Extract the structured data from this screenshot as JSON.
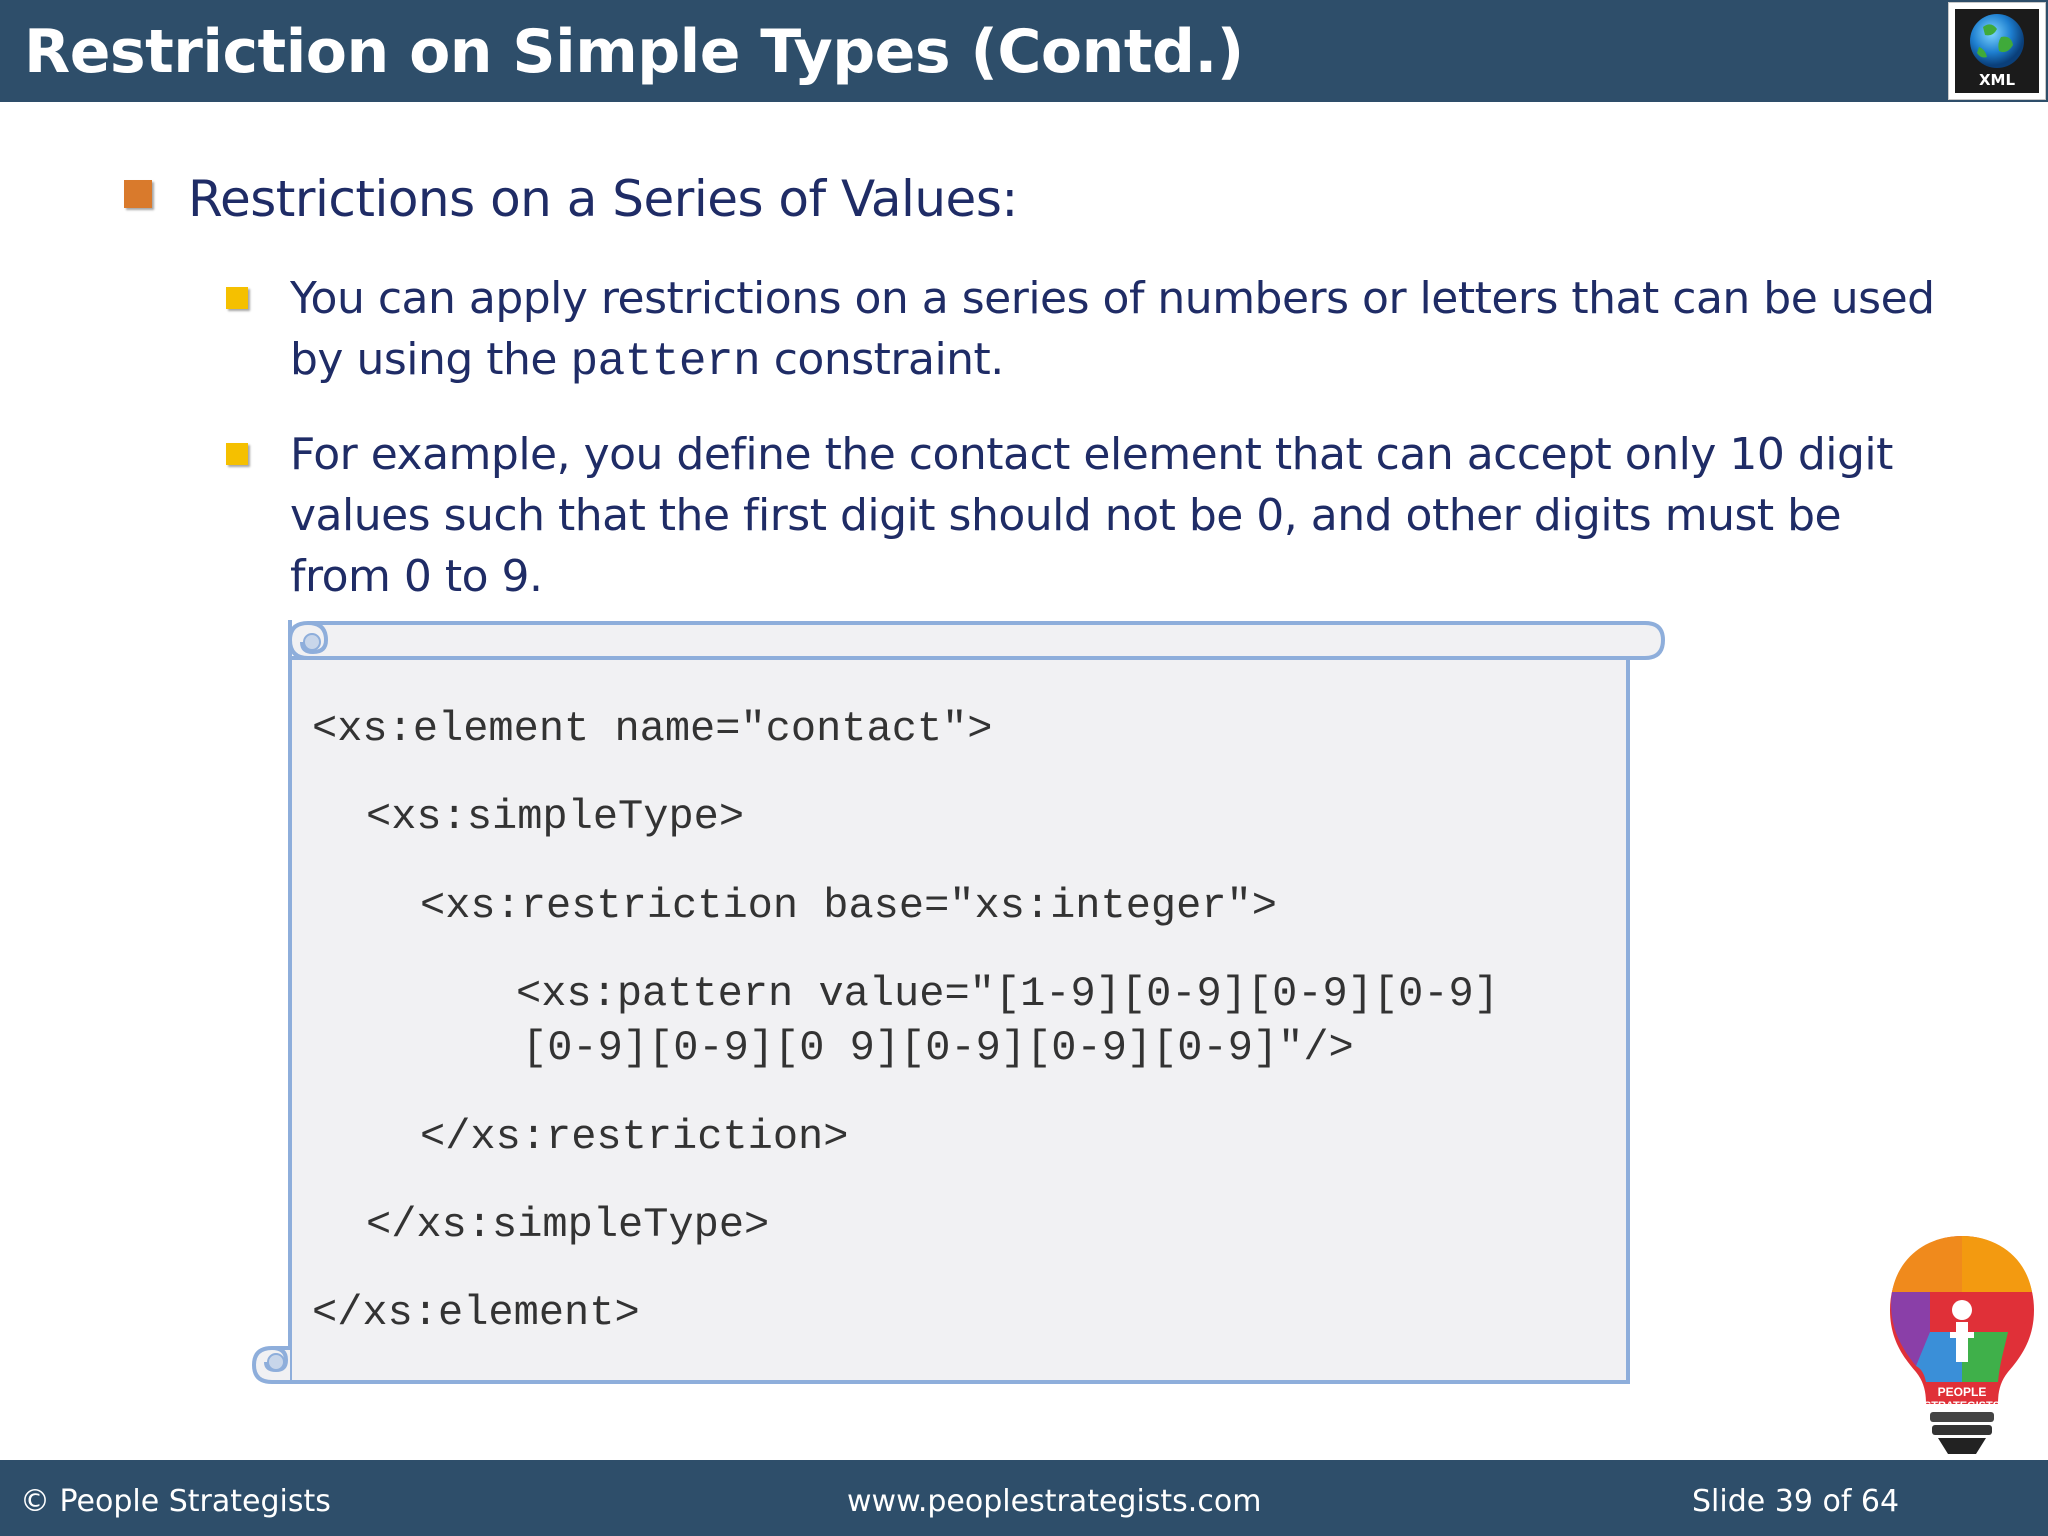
{
  "header": {
    "title": "Restriction on Simple Types (Contd.)",
    "badge_label": "XML",
    "bg_color": "#2e4e6a"
  },
  "content": {
    "heading": "Restrictions on a Series of Values:",
    "bullet1_before": "You can apply restrictions on a series of numbers or letters that can be used by using the ",
    "bullet1_code": "pattern",
    "bullet1_after": " constraint.",
    "bullet2": "For example, you define the contact element that can accept only 10 digit values such that the first digit should not be 0, and other digits must be from 0 to 9."
  },
  "code": {
    "lines": [
      "<xs:element name=\"contact\">",
      "<xs:simpleType>",
      "<xs:restriction base=\"xs:integer\">",
      "<xs:pattern value=\"[1-9][0-9][0-9][0-9]",
      "[0-9][0-9][0 9][0-9][0-9][0-9]\"/>",
      "</xs:restriction>",
      "</xs:simpleType>",
      "</xs:element>"
    ]
  },
  "footer": {
    "copyright": "© People Strategists",
    "website": "www.peoplestrategists.com",
    "slide_number": "Slide 39 of 64"
  },
  "logo": {
    "text_line1": "PEOPLE",
    "text_line2": "STRATEGISTS"
  },
  "colors": {
    "heading_bullet": "#d97a2c",
    "sub_bullet": "#f5c000",
    "body_text": "#1f2c66",
    "scroll_border": "#8eaedb",
    "scroll_fill": "#f1f1f3"
  }
}
